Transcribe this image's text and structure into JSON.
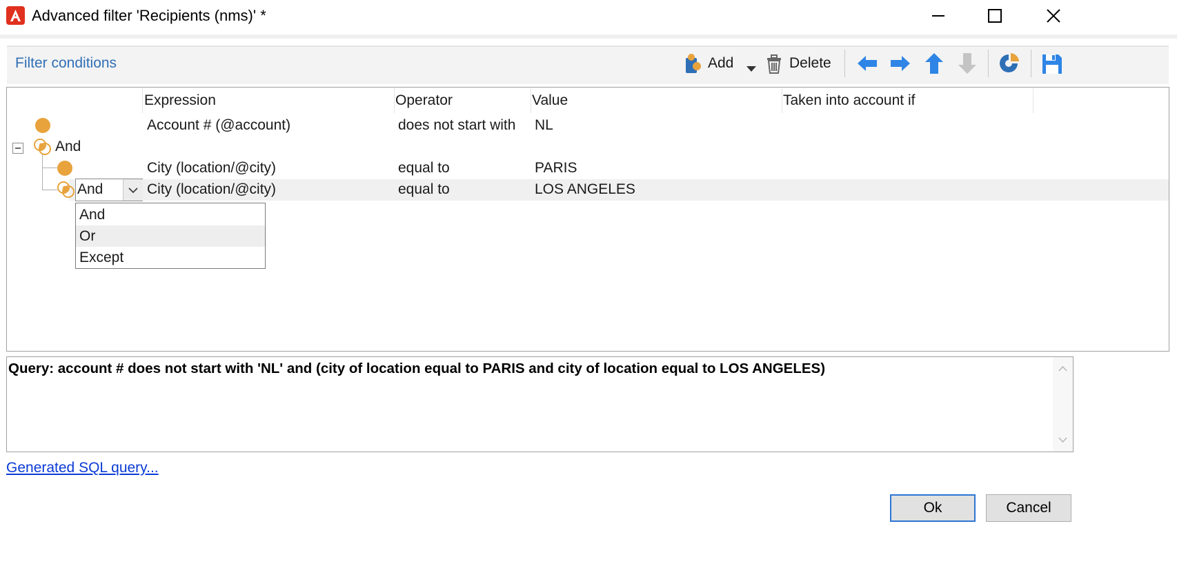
{
  "window": {
    "title": "Advanced filter 'Recipients (nms)' *"
  },
  "toolbar": {
    "section_title": "Filter conditions",
    "add_label": "Add",
    "delete_label": "Delete"
  },
  "grid": {
    "columns": [
      "Expression",
      "Operator",
      "Value",
      "Taken into account if"
    ],
    "rows": [
      {
        "expression": "Account # (@account)",
        "operator": "does not start with",
        "value": "NL"
      },
      {
        "group": "And"
      },
      {
        "expression": "City (location/@city)",
        "operator": "equal to",
        "value": "PARIS"
      },
      {
        "combo": "And",
        "expression": "City (location/@city)",
        "operator": "equal to",
        "value": "LOS ANGELES"
      }
    ]
  },
  "dropdown": {
    "options": [
      "And",
      "Or",
      "Except"
    ],
    "hovered": "Or"
  },
  "query": {
    "text": "Query: account # does not start with 'NL' and (city of location equal to PARIS and city of location equal to LOS ANGELES)"
  },
  "links": {
    "sql": "Generated SQL query..."
  },
  "buttons": {
    "ok": "Ok",
    "cancel": "Cancel"
  },
  "colors": {
    "accent": "#2f6fb6",
    "condition_orange": "#e8a33d",
    "app_red": "#e0301e"
  }
}
